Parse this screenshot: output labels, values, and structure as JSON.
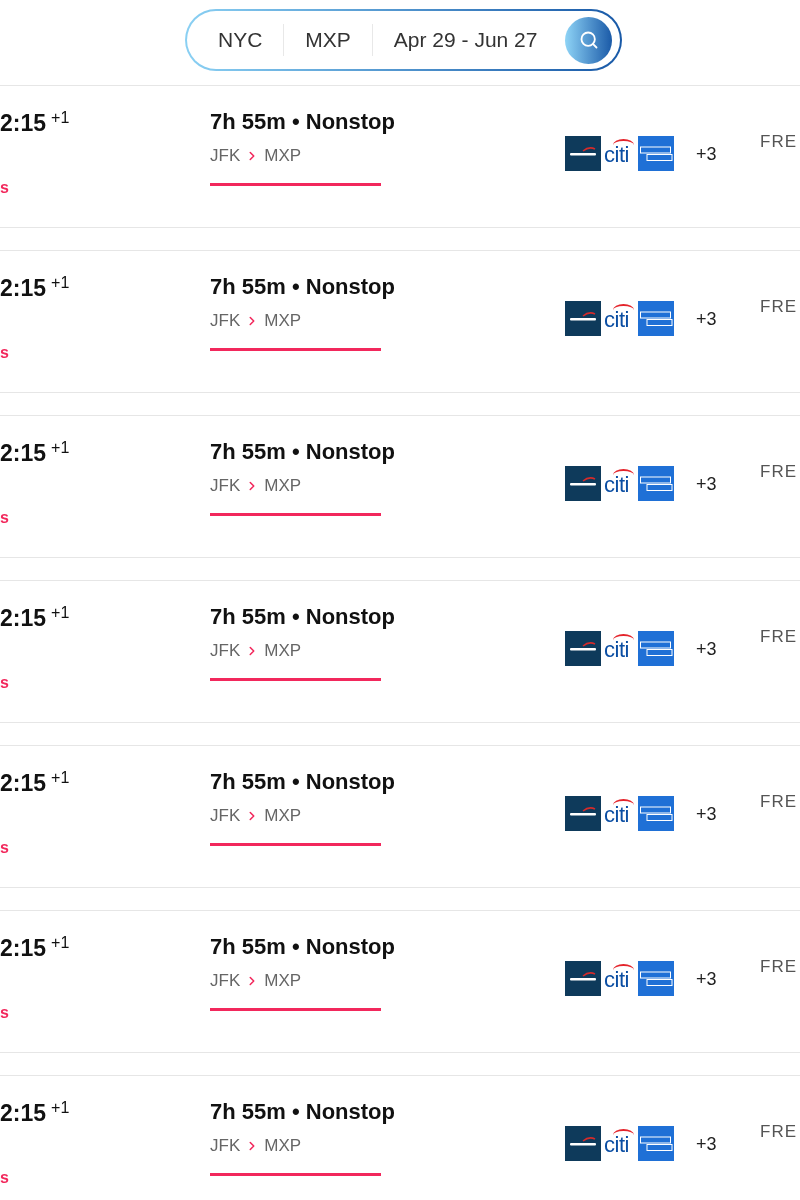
{
  "search": {
    "origin": "NYC",
    "destination": "MXP",
    "dates": "Apr 29 - Jun 27"
  },
  "flights": [
    {
      "arrival_time": "2:15",
      "day_offset": "+1",
      "note": "s",
      "duration": "7h 55m • Nonstop",
      "from": "JFK",
      "to": "MXP",
      "cards": [
        {
          "kind": "swoosh",
          "color": "#0e3a5b"
        },
        {
          "kind": "arc",
          "text": "citi"
        },
        {
          "kind": "boxed",
          "color": "#1f70d6"
        }
      ],
      "more_cards": "+3",
      "price": "FRE"
    },
    {
      "arrival_time": "2:15",
      "day_offset": "+1",
      "note": "s",
      "duration": "7h 55m • Nonstop",
      "from": "JFK",
      "to": "MXP",
      "cards": [
        {
          "kind": "swoosh",
          "color": "#0e3a5b"
        },
        {
          "kind": "arc",
          "text": "citi"
        },
        {
          "kind": "boxed",
          "color": "#1f70d6"
        }
      ],
      "more_cards": "+3",
      "price": "FRE"
    },
    {
      "arrival_time": "2:15",
      "day_offset": "+1",
      "note": "s",
      "duration": "7h 55m • Nonstop",
      "from": "JFK",
      "to": "MXP",
      "cards": [
        {
          "kind": "swoosh",
          "color": "#0e3a5b"
        },
        {
          "kind": "arc",
          "text": "citi"
        },
        {
          "kind": "boxed",
          "color": "#1f70d6"
        }
      ],
      "more_cards": "+3",
      "price": "FRE"
    },
    {
      "arrival_time": "2:15",
      "day_offset": "+1",
      "note": "s",
      "duration": "7h 55m • Nonstop",
      "from": "JFK",
      "to": "MXP",
      "cards": [
        {
          "kind": "swoosh",
          "color": "#0e3a5b"
        },
        {
          "kind": "arc",
          "text": "citi"
        },
        {
          "kind": "boxed",
          "color": "#1f70d6"
        }
      ],
      "more_cards": "+3",
      "price": "FRE"
    },
    {
      "arrival_time": "2:15",
      "day_offset": "+1",
      "note": "s",
      "duration": "7h 55m • Nonstop",
      "from": "JFK",
      "to": "MXP",
      "cards": [
        {
          "kind": "swoosh",
          "color": "#0e3a5b"
        },
        {
          "kind": "arc",
          "text": "citi"
        },
        {
          "kind": "boxed",
          "color": "#1f70d6"
        }
      ],
      "more_cards": "+3",
      "price": "FRE"
    },
    {
      "arrival_time": "2:15",
      "day_offset": "+1",
      "note": "s",
      "duration": "7h 55m • Nonstop",
      "from": "JFK",
      "to": "MXP",
      "cards": [
        {
          "kind": "swoosh",
          "color": "#0e3a5b"
        },
        {
          "kind": "arc",
          "text": "citi"
        },
        {
          "kind": "boxed",
          "color": "#1f70d6"
        }
      ],
      "more_cards": "+3",
      "price": "FRE"
    },
    {
      "arrival_time": "2:15",
      "day_offset": "+1",
      "note": "s",
      "duration": "7h 55m • Nonstop",
      "from": "JFK",
      "to": "MXP",
      "cards": [
        {
          "kind": "swoosh",
          "color": "#0e3a5b"
        },
        {
          "kind": "arc",
          "text": "citi"
        },
        {
          "kind": "boxed",
          "color": "#1f70d6"
        }
      ],
      "more_cards": "+3",
      "price": "FRE"
    }
  ]
}
